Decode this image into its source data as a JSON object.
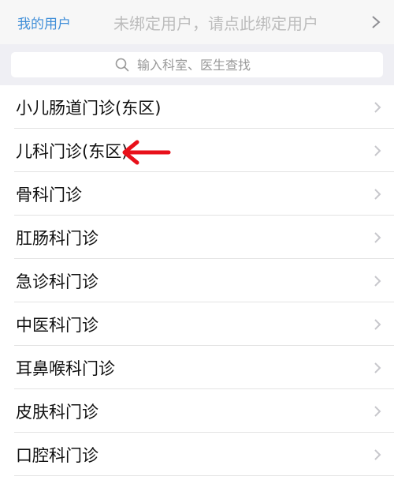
{
  "user_bar": {
    "title": "我的用户",
    "bind_tip": "未绑定用户，请点此绑定用户"
  },
  "search": {
    "placeholder": "输入科室、医生查找"
  },
  "departments": [
    {
      "label": "小儿肠道门诊(东区)"
    },
    {
      "label": "儿科门诊(东区)"
    },
    {
      "label": "骨科门诊"
    },
    {
      "label": "肛肠科门诊"
    },
    {
      "label": "急诊科门诊"
    },
    {
      "label": "中医科门诊"
    },
    {
      "label": "耳鼻喉科门诊"
    },
    {
      "label": "皮肤科门诊"
    },
    {
      "label": "口腔科门诊"
    }
  ],
  "colors": {
    "accent": "#3f8ed8",
    "annotation_arrow": "#e8101a"
  },
  "icons": {
    "chevron": "chevron-right-icon",
    "search": "search-icon",
    "annotation": "red-arrow-icon"
  }
}
